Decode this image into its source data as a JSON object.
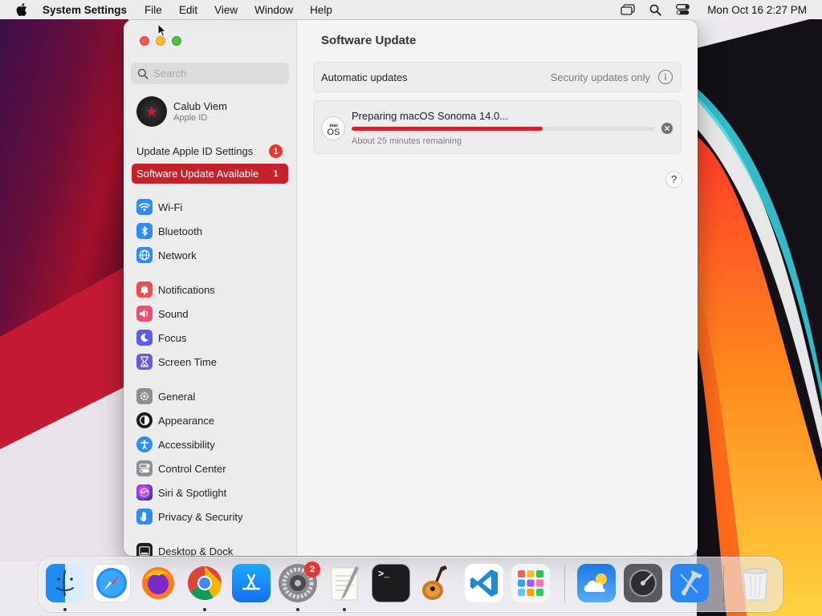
{
  "menubar": {
    "app_name": "System Settings",
    "menus": [
      "File",
      "Edit",
      "View",
      "Window",
      "Help"
    ],
    "clock": "Mon Oct 16  2:27 PM",
    "status_icons": [
      "screen-mirroring-icon",
      "spotlight-search-icon",
      "control-center-icon"
    ]
  },
  "sidebar": {
    "search_placeholder": "Search",
    "account": {
      "name": "Calub Viem",
      "subtitle": "Apple ID"
    },
    "notices": [
      {
        "label": "Update Apple ID Settings",
        "badge": "1"
      },
      {
        "label": "Software Update Available",
        "badge": "1"
      }
    ],
    "items": [
      {
        "label": "Wi-Fi",
        "icon": "wifi-icon",
        "color": "#2f8cf6"
      },
      {
        "label": "Bluetooth",
        "icon": "bluetooth-icon",
        "color": "#2f8cf6"
      },
      {
        "label": "Network",
        "icon": "globe-icon",
        "color": "#2f8cf6"
      },
      {
        "label": "Notifications",
        "icon": "notifications-icon",
        "color": "#ef4d4d"
      },
      {
        "label": "Sound",
        "icon": "speaker-icon",
        "color": "#ef4d6d"
      },
      {
        "label": "Focus",
        "icon": "moon-icon",
        "color": "#5e5ce6"
      },
      {
        "label": "Screen Time",
        "icon": "hourglass-icon",
        "color": "#6a5acd"
      },
      {
        "label": "General",
        "icon": "gear-icon",
        "color": "#8e8e93"
      },
      {
        "label": "Appearance",
        "icon": "appearance-icon",
        "color": "#1c1c1e"
      },
      {
        "label": "Accessibility",
        "icon": "accessibility-icon",
        "color": "#2f8cf6"
      },
      {
        "label": "Control Center",
        "icon": "control-center-icon",
        "color": "#8e8e93"
      },
      {
        "label": "Siri & Spotlight",
        "icon": "siri-icon",
        "color": "#c2468c"
      },
      {
        "label": "Privacy & Security",
        "icon": "hand-icon",
        "color": "#2f8cf6"
      },
      {
        "label": "Desktop & Dock",
        "icon": "dock-icon",
        "color": "#1c1c1e"
      }
    ]
  },
  "main": {
    "title": "Software Update",
    "automatic_updates": {
      "label": "Automatic updates",
      "value": "Security updates only"
    },
    "update": {
      "title": "Preparing macOS Sonoma 14.0...",
      "status": "About 25 minutes remaining",
      "progress": 0.63,
      "os_icon_line1": "mac",
      "os_icon_line2": "OS"
    },
    "help_label": "?"
  },
  "dock": {
    "apps": [
      {
        "name": "Finder",
        "running": true
      },
      {
        "name": "Safari",
        "running": false
      },
      {
        "name": "Firefox",
        "running": false
      },
      {
        "name": "Chrome",
        "running": true
      },
      {
        "name": "App Store",
        "running": false
      },
      {
        "name": "System Settings",
        "running": true,
        "badge": "2"
      },
      {
        "name": "TextEdit",
        "running": true
      },
      {
        "name": "Terminal",
        "running": false
      },
      {
        "name": "GarageBand",
        "running": false
      },
      {
        "name": "Visual Studio Code",
        "running": false
      },
      {
        "name": "Launchpad",
        "running": false
      },
      {
        "name": "Weather",
        "running": false
      },
      {
        "name": "Disk Utility",
        "running": false
      },
      {
        "name": "Xcode",
        "running": false
      },
      {
        "name": "Trash",
        "running": false
      }
    ],
    "terminal_prompt": ">_"
  },
  "colors": {
    "accent": "#c4222a",
    "badge": "#e5382f",
    "progress": "#d2222e"
  }
}
